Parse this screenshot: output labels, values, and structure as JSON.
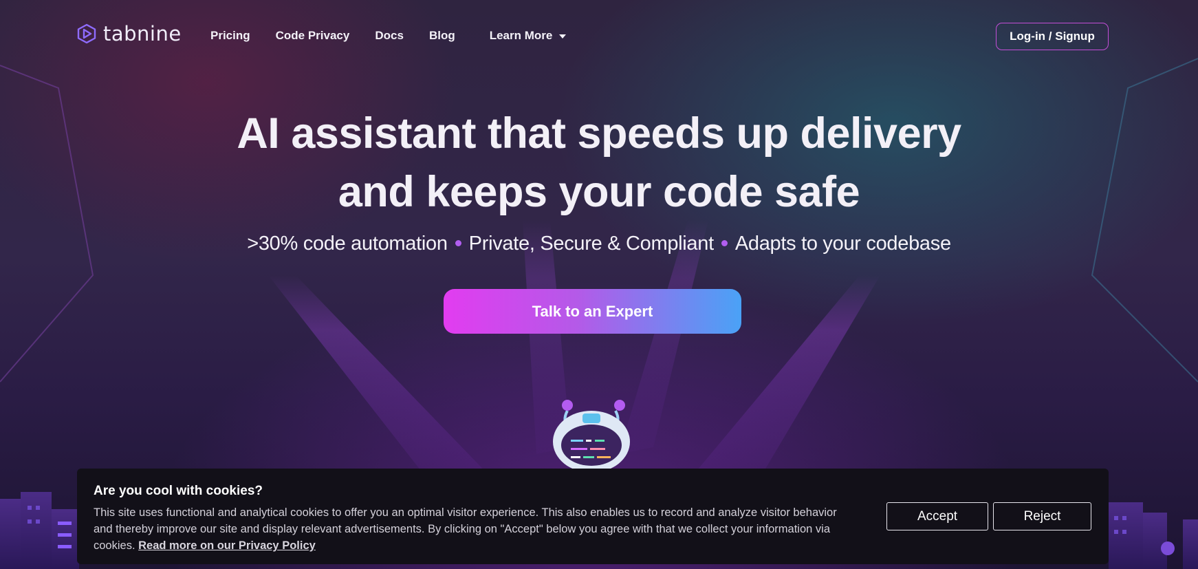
{
  "brand": {
    "name": "tabnine",
    "logo_icon": "hexagon-play-icon"
  },
  "nav": {
    "links": [
      "Pricing",
      "Code Privacy",
      "Docs",
      "Blog"
    ],
    "learn_more": "Learn More",
    "learn_more_icon": "chevron-down-icon",
    "login_label": "Log-in / Signup"
  },
  "hero": {
    "title_line1": "AI assistant that speeds up delivery",
    "title_line2": "and keeps your code safe",
    "features": [
      ">30% code automation",
      "Private, Secure & Compliant",
      "Adapts to your codebase"
    ],
    "cta_label": "Talk to an Expert"
  },
  "cookie_banner": {
    "title": "Are you cool with cookies?",
    "text": "This site uses functional and analytical cookies to offer you an optimal visitor experience. This also enables us to record and analyze visitor behavior and thereby improve our site and display relevant advertisements. By clicking on \"Accept\" below you agree with that we collect your information via cookies.",
    "link_label": "Read more on our Privacy Policy",
    "accept_label": "Accept",
    "reject_label": "Reject"
  },
  "colors": {
    "accent_pink": "#e23cf0",
    "accent_blue": "#4aa2f6",
    "login_border": "#c44fd8",
    "bullet_dot": "#b15ef0",
    "banner_bg": "#121018"
  }
}
